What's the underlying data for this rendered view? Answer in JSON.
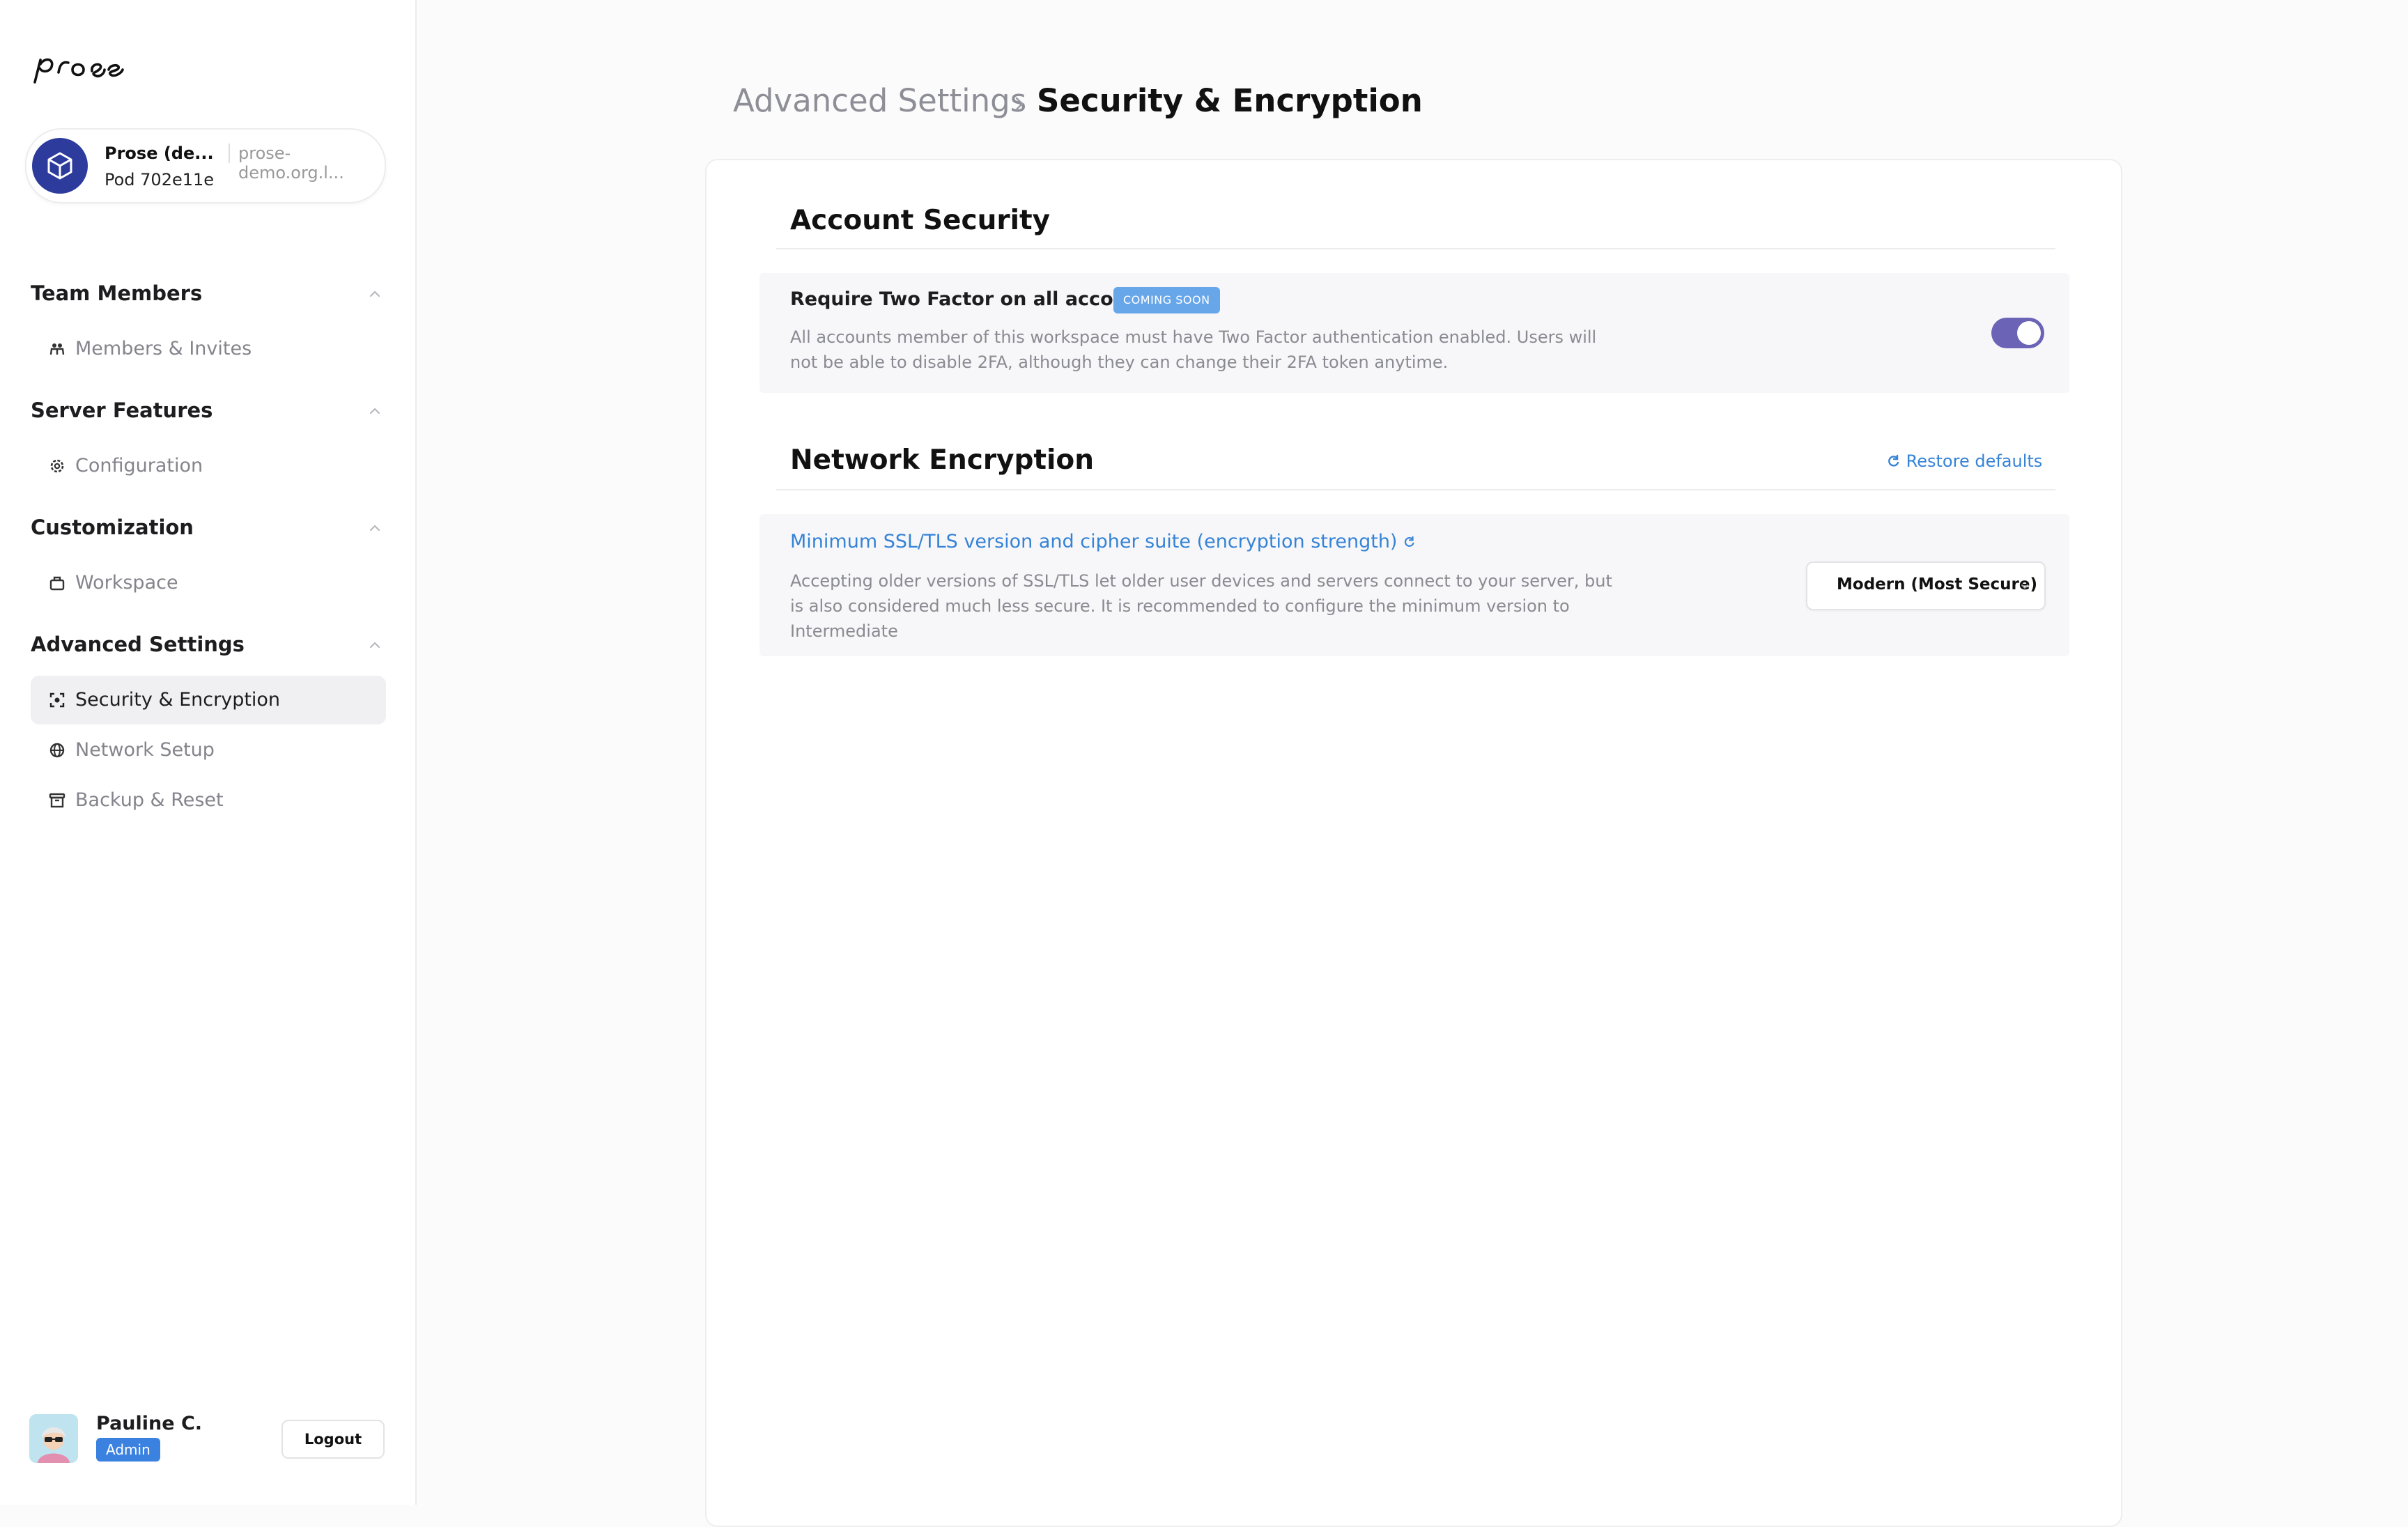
{
  "app": {
    "logo_text": "prose"
  },
  "pod": {
    "name": "Prose (de...",
    "domain": "prose-demo.org.l...",
    "id": "Pod 702e11e"
  },
  "sidebar": {
    "sections": [
      {
        "title": "Team Members",
        "items": [
          {
            "label": "Members & Invites",
            "icon": "members-icon"
          }
        ]
      },
      {
        "title": "Server Features",
        "items": [
          {
            "label": "Configuration",
            "icon": "gear-icon"
          }
        ]
      },
      {
        "title": "Customization",
        "items": [
          {
            "label": "Workspace",
            "icon": "briefcase-icon"
          }
        ]
      },
      {
        "title": "Advanced Settings",
        "items": [
          {
            "label": "Security & Encryption",
            "icon": "security-scan-icon",
            "active": true
          },
          {
            "label": "Network Setup",
            "icon": "globe-icon"
          },
          {
            "label": "Backup & Reset",
            "icon": "archive-icon"
          }
        ]
      }
    ]
  },
  "user": {
    "name": "Pauline C.",
    "role": "Admin",
    "logout_label": "Logout"
  },
  "breadcrumb": {
    "parent": "Advanced Settings",
    "current": "Security & Encryption"
  },
  "account_security": {
    "title": "Account Security",
    "two_factor": {
      "title": "Require Two Factor on all accounts",
      "badge": "COMING SOON",
      "description_line1": "All accounts member of this workspace must have Two Factor authentication enabled. Users will",
      "description_line2": "not be able to disable 2FA, although they can change their 2FA token anytime.",
      "enabled": true
    }
  },
  "network_encryption": {
    "title": "Network Encryption",
    "restore_label": "Restore defaults",
    "tls": {
      "title": "Minimum SSL/TLS version and cipher suite (encryption strength)",
      "description_line1": "Accepting older versions of SSL/TLS let older user devices and servers connect to your server, but",
      "description_line2": "is also considered much less secure. It is recommended to configure the minimum version to",
      "description_line3": "Intermediate",
      "selected": "Modern (Most Secure)"
    }
  },
  "colors": {
    "accent": "#6b63b6",
    "link": "#3583d6",
    "badge": "#68a6ea",
    "admin_badge": "#3b82e0",
    "pod_avatar": "#2c3b9c"
  }
}
